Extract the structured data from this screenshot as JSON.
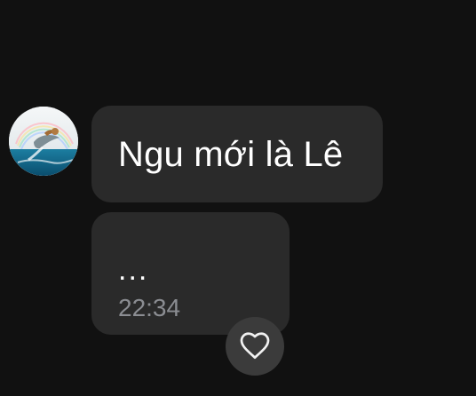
{
  "messages": [
    {
      "text": "Ngu mới là Lê"
    },
    {
      "text": "...",
      "time": "22:34"
    }
  ],
  "colors": {
    "background": "#111111",
    "bubble": "#2a2a2a",
    "time_text": "#8b8d92",
    "reaction_button": "#3b3b3b"
  },
  "icons": {
    "avatar": "avatar-image",
    "reaction": "heart-outline-icon"
  }
}
